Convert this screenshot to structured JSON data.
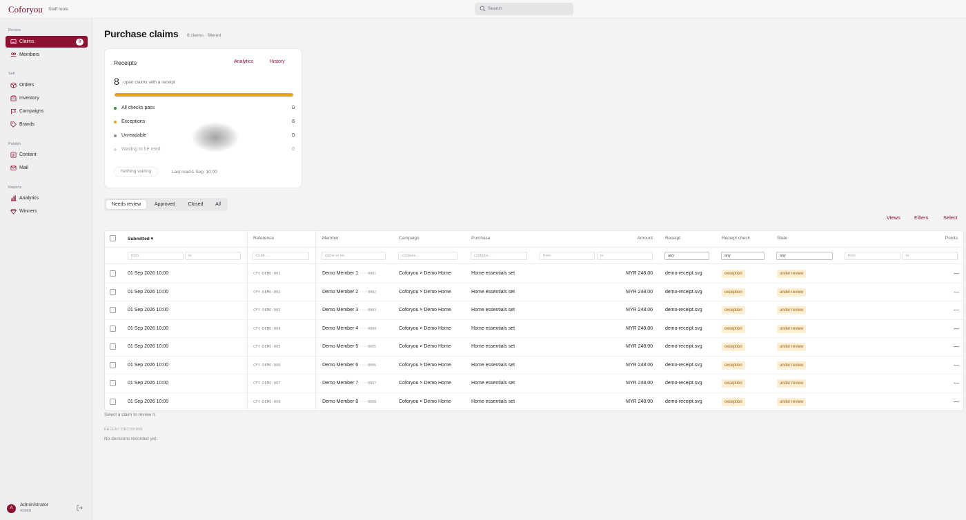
{
  "app": {
    "brand": "Coforyou",
    "subtitle": "Staff tools"
  },
  "search": {
    "placeholder": "Search"
  },
  "sidebar": {
    "sections": [
      {
        "label": "Review",
        "items": [
          {
            "label": "Claims",
            "icon": "receipt-icon",
            "badge": "8",
            "active": true
          },
          {
            "label": "Members",
            "icon": "users-icon"
          }
        ]
      },
      {
        "label": "Sell",
        "items": [
          {
            "label": "Orders",
            "icon": "box-icon"
          },
          {
            "label": "Inventory",
            "icon": "inventory-icon"
          },
          {
            "label": "Campaigns",
            "icon": "flag-icon"
          },
          {
            "label": "Brands",
            "icon": "tag-icon"
          }
        ]
      },
      {
        "label": "Publish",
        "items": [
          {
            "label": "Content",
            "icon": "document-icon"
          },
          {
            "label": "Mail",
            "icon": "mail-icon"
          }
        ]
      },
      {
        "label": "Reports",
        "items": [
          {
            "label": "Analytics",
            "icon": "chart-icon"
          },
          {
            "label": "Winners",
            "icon": "diamond-icon"
          }
        ]
      }
    ],
    "user": {
      "initial": "A",
      "name": "Administrator",
      "role": "ADMIN"
    }
  },
  "page": {
    "title": "Purchase claims",
    "subtitle": "8 claims · filtered"
  },
  "receipts_card": {
    "title": "Receipts",
    "links": {
      "analytics": "Analytics",
      "history": "History"
    },
    "count": "8",
    "count_label": "open claims with a receipt",
    "progress": 1.0,
    "stats": [
      {
        "label": "All checks pass",
        "value": "0",
        "color": "#2e8b3e"
      },
      {
        "label": "Exceptions",
        "value": "8",
        "color": "#e3a21a"
      },
      {
        "label": "Unreadable",
        "value": "0",
        "color": "#8a8a90"
      },
      {
        "label": "Waiting to be read",
        "value": "0",
        "color": "#d8d8dc"
      }
    ],
    "nothing_waiting": "Nothing waiting",
    "last_read": "Last read 1 Sep, 10:00"
  },
  "tabs": [
    "Needs review",
    "Approved",
    "Closed",
    "All"
  ],
  "actions": {
    "views": "Views",
    "filters": "Filters",
    "select": "Select"
  },
  "table": {
    "headers": {
      "submitted": "Submitted",
      "sort_arrow": "▾",
      "reference": "Reference",
      "member": "Member",
      "campaign": "Campaign",
      "purchase": "Purchase",
      "amount": "Amount",
      "receipt": "Receipt",
      "receipt_check": "Receipt check",
      "state": "State",
      "points": "Points"
    },
    "filters": {
      "submitted_from": "from",
      "submitted_to": "to",
      "reference": "CLM-…",
      "member": "name or no.",
      "campaign": "contains…",
      "purchase": "contains…",
      "amount_from": "from",
      "amount_to": "to",
      "receipt": "any",
      "receipt_check": "any",
      "state": "any",
      "points_from": "from",
      "points_to": "to"
    },
    "rows": [
      {
        "submitted": "01 Sep 2026 10:00",
        "reference": "CFY-DEMO-001",
        "member": "Demo Member 1",
        "member_no": "····0001",
        "campaign": "Coforyou × Demo Home",
        "purchase": "Home essentials set",
        "amount": "MYR 248.00",
        "receipt": "demo-receipt.svg",
        "check": "exception",
        "state": "under review",
        "points": "—"
      },
      {
        "submitted": "01 Sep 2026 10:00",
        "reference": "CFY-DEMO-002",
        "member": "Demo Member 2",
        "member_no": "····0002",
        "campaign": "Coforyou × Demo Home",
        "purchase": "Home essentials set",
        "amount": "MYR 248.00",
        "receipt": "demo-receipt.svg",
        "check": "exception",
        "state": "under review",
        "points": "—"
      },
      {
        "submitted": "01 Sep 2026 10:00",
        "reference": "CFY-DEMO-003",
        "member": "Demo Member 3",
        "member_no": "····0003",
        "campaign": "Coforyou × Demo Home",
        "purchase": "Home essentials set",
        "amount": "MYR 248.00",
        "receipt": "demo-receipt.svg",
        "check": "exception",
        "state": "under review",
        "points": "—"
      },
      {
        "submitted": "01 Sep 2026 10:00",
        "reference": "CFY-DEMO-004",
        "member": "Demo Member 4",
        "member_no": "····0004",
        "campaign": "Coforyou × Demo Home",
        "purchase": "Home essentials set",
        "amount": "MYR 248.00",
        "receipt": "demo-receipt.svg",
        "check": "exception",
        "state": "under review",
        "points": "—"
      },
      {
        "submitted": "01 Sep 2026 10:00",
        "reference": "CFY-DEMO-005",
        "member": "Demo Member 5",
        "member_no": "····0005",
        "campaign": "Coforyou × Demo Home",
        "purchase": "Home essentials set",
        "amount": "MYR 248.00",
        "receipt": "demo-receipt.svg",
        "check": "exception",
        "state": "under review",
        "points": "—"
      },
      {
        "submitted": "01 Sep 2026 10:00",
        "reference": "CFY-DEMO-006",
        "member": "Demo Member 6",
        "member_no": "····0006",
        "campaign": "Coforyou × Demo Home",
        "purchase": "Home essentials set",
        "amount": "MYR 248.00",
        "receipt": "demo-receipt.svg",
        "check": "exception",
        "state": "under review",
        "points": "—"
      },
      {
        "submitted": "01 Sep 2026 10:00",
        "reference": "CFY-DEMO-007",
        "member": "Demo Member 7",
        "member_no": "····0007",
        "campaign": "Coforyou × Demo Home",
        "purchase": "Home essentials set",
        "amount": "MYR 248.00",
        "receipt": "demo-receipt.svg",
        "check": "exception",
        "state": "under review",
        "points": "—"
      },
      {
        "submitted": "01 Sep 2026 10:00",
        "reference": "CFY-DEMO-008",
        "member": "Demo Member 8",
        "member_no": "····0008",
        "campaign": "Coforyou × Demo Home",
        "purchase": "Home essentials set",
        "amount": "MYR 248.00",
        "receipt": "demo-receipt.svg",
        "check": "exception",
        "state": "under review",
        "points": "—"
      }
    ]
  },
  "footer": {
    "hint": "Select a claim to review it.",
    "recent_label": "RECENT DECISIONS",
    "recent_empty": "No decisions recorded yet."
  },
  "colors": {
    "accent": "#8b1230",
    "warning": "#e3a21a",
    "success": "#2e8b3e"
  }
}
